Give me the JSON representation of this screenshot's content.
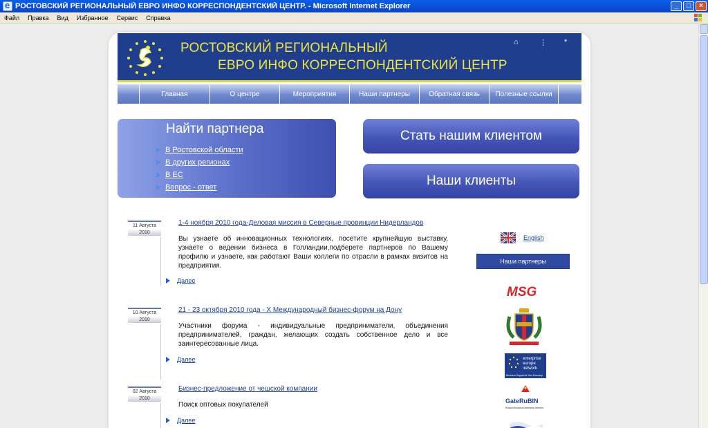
{
  "window": {
    "title": "РОСТОВСКИЙ РЕГИОНАЛЬНЫЙ ЕВРО ИНФО КОРРЕСПОНДЕНТСКИЙ ЦЕНТР. - Microsoft Internet Explorer",
    "buttons": {
      "minimize": "_",
      "maximize": "□",
      "close": "×"
    }
  },
  "menu": [
    "Файл",
    "Правка",
    "Вид",
    "Избранное",
    "Сервис",
    "Справка"
  ],
  "header": {
    "line1": "РОСТОВСКИЙ РЕГИОНАЛЬНЫЙ",
    "line2": "ЕВРО ИНФО КОРРЕСПОНДЕНТСКИЙ ЦЕНТР",
    "icons": {
      "home": "⌂",
      "sitemap": "⋮",
      "star": "*"
    }
  },
  "nav": [
    "Главная",
    "О центре",
    "Мероприятия",
    "Наши партнеры",
    "Обратная связь",
    "Полезные ссылки"
  ],
  "find_partner": {
    "title": "Найти партнера",
    "links": [
      "В Ростовской области",
      "В других регионах",
      "В ЕС",
      "Вопрос - ответ"
    ]
  },
  "buttons": {
    "become_client": "Стать нашим клиентом",
    "our_clients": "Наши клиенты"
  },
  "news": [
    {
      "date_line1": "11 Августа",
      "date_line2": "2010",
      "title": "1-4 ноября 2010 года-Деловая миссия в Северные провинции Нидерландов",
      "body": "Вы узнаете об инновационных технологиях, посетите крупнейшую выставку, узнаете о ведении бизнеса в Голландии,подберете партнеров по Вашему профилю и узнаете, как работают Ваши коллеги по отрасли в рамках визитов на предприятия.",
      "more": "Далее"
    },
    {
      "date_line1": "10 Августа",
      "date_line2": "2010",
      "title": "21 - 23 октября 2010 года - X Международный бизнес-форум на Дону",
      "body": "Участники форума - индивидуальные предприниматели, объединения предпринимателей, граждан, желающих создать собственное дело и все заинтересованные лица.",
      "more": "Далее"
    },
    {
      "date_line1": "02 Августа",
      "date_line2": "2010",
      "title": "Бизнес-предложение от чешской компании",
      "body": "Поиск оптовых покупателей",
      "more": "Далее"
    }
  ],
  "sidebar": {
    "english": "English",
    "partners": "Наши партнеры",
    "logos": {
      "msg": "MSG",
      "een_line1": "enterprise",
      "een_line2": "europe",
      "een_line3": "network",
      "een_tag": "Business Support at Your Doorstep",
      "gate": "GateRuBIN",
      "gate_sub": "Russian Business Information Network"
    }
  },
  "colors": {
    "brand_blue": "#1f3f8e",
    "accent_yellow": "#f1e43a"
  }
}
